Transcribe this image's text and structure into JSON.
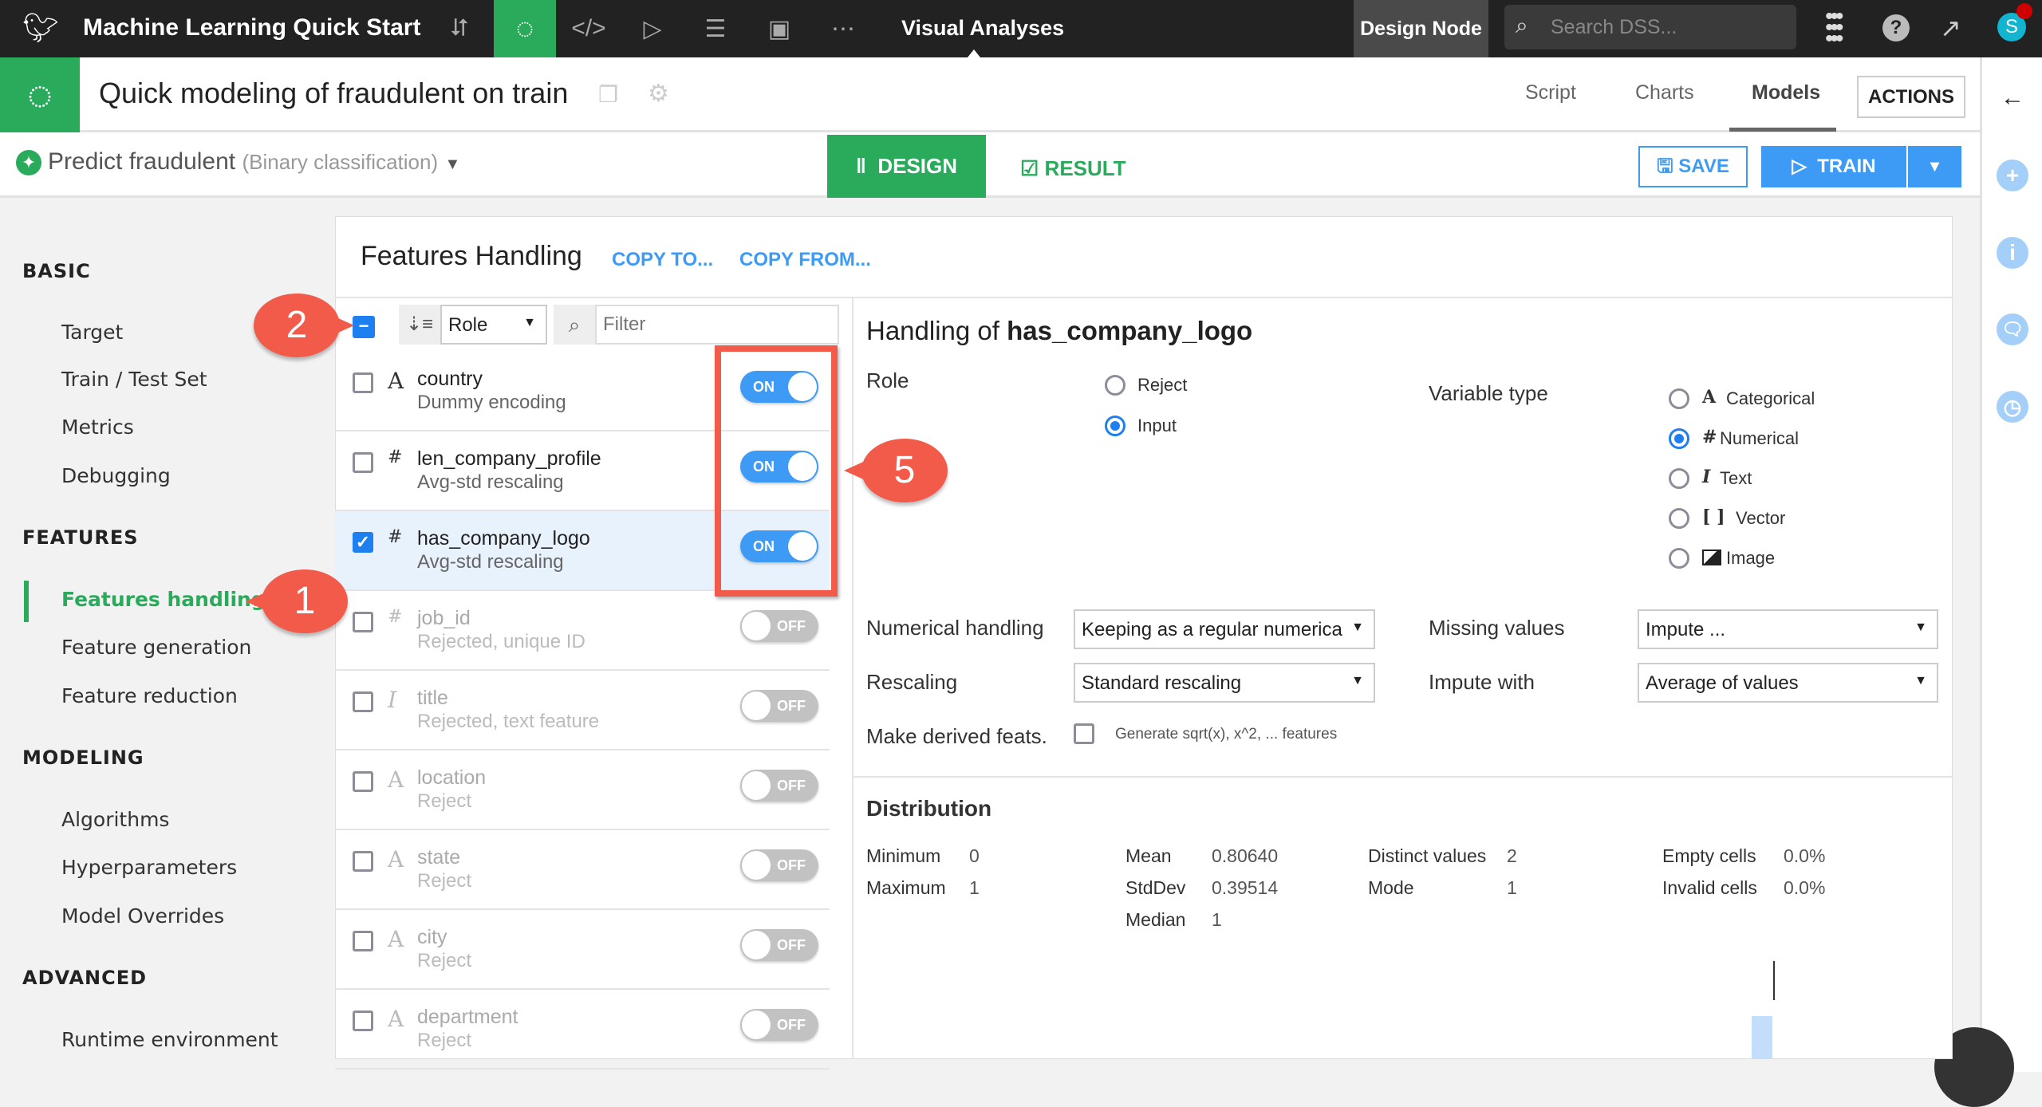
{
  "topbar": {
    "project_title": "Machine Learning Quick Start",
    "section": "Visual Analyses",
    "node": "Design Node",
    "search_placeholder": "Search DSS...",
    "avatar_letter": "S",
    "help": "?"
  },
  "header": {
    "title": "Quick modeling of fraudulent on train",
    "tabs": [
      "Script",
      "Charts",
      "Models"
    ],
    "active_tab": "Models",
    "actions_label": "ACTIONS"
  },
  "task": {
    "name": "Predict fraudulent",
    "type": "(Binary classification)",
    "design_label": "DESIGN",
    "result_label": "RESULT",
    "save_label": "SAVE",
    "train_label": "TRAIN"
  },
  "sidebar": {
    "sections": [
      {
        "title": "BASIC",
        "items": [
          "Target",
          "Train / Test Set",
          "Metrics",
          "Debugging"
        ]
      },
      {
        "title": "FEATURES",
        "items": [
          "Features handling",
          "Feature generation",
          "Feature reduction"
        ]
      },
      {
        "title": "MODELING",
        "items": [
          "Algorithms",
          "Hyperparameters",
          "Model Overrides"
        ]
      },
      {
        "title": "ADVANCED",
        "items": [
          "Runtime environment"
        ]
      }
    ],
    "active_item": "Features handling"
  },
  "features": {
    "title": "Features Handling",
    "copy_to": "COPY TO...",
    "copy_from": "COPY FROM...",
    "sort_value": "Role",
    "filter_placeholder": "Filter",
    "rows": [
      {
        "type": "A",
        "name": "country",
        "desc": "Dummy encoding",
        "enabled": true,
        "checked": false,
        "toggle": "ON"
      },
      {
        "type": "#",
        "name": "len_company_profile",
        "desc": "Avg-std rescaling",
        "enabled": true,
        "checked": false,
        "toggle": "ON"
      },
      {
        "type": "#",
        "name": "has_company_logo",
        "desc": "Avg-std rescaling",
        "enabled": true,
        "checked": true,
        "toggle": "ON"
      },
      {
        "type": "#",
        "name": "job_id",
        "desc": "Rejected, unique ID",
        "enabled": false,
        "checked": false,
        "toggle": "OFF"
      },
      {
        "type": "I",
        "name": "title",
        "desc": "Rejected, text feature",
        "enabled": false,
        "checked": false,
        "toggle": "OFF"
      },
      {
        "type": "A",
        "name": "location",
        "desc": "Reject",
        "enabled": false,
        "checked": false,
        "toggle": "OFF"
      },
      {
        "type": "A",
        "name": "state",
        "desc": "Reject",
        "enabled": false,
        "checked": false,
        "toggle": "OFF"
      },
      {
        "type": "A",
        "name": "city",
        "desc": "Reject",
        "enabled": false,
        "checked": false,
        "toggle": "OFF"
      },
      {
        "type": "A",
        "name": "department",
        "desc": "Reject",
        "enabled": false,
        "checked": false,
        "toggle": "OFF"
      }
    ]
  },
  "detail": {
    "heading_prefix": "Handling of",
    "feature": "has_company_logo",
    "role_label": "Role",
    "roles": [
      "Reject",
      "Input"
    ],
    "role_selected": "Input",
    "vartype_label": "Variable type",
    "vartypes": [
      {
        "icon": "A",
        "label": "Categorical"
      },
      {
        "icon": "#",
        "label": "Numerical"
      },
      {
        "icon": "I",
        "label": "Text"
      },
      {
        "icon": "[ ]",
        "label": "Vector"
      },
      {
        "icon": "image",
        "label": "Image"
      }
    ],
    "vartype_selected": "Numerical",
    "numerical_handling_label": "Numerical handling",
    "numerical_handling": "Keeping as a regular numerica",
    "missing_label": "Missing values",
    "missing": "Impute ...",
    "rescaling_label": "Rescaling",
    "rescaling": "Standard rescaling",
    "impute_label": "Impute with",
    "impute": "Average of values",
    "derived_label": "Make derived feats.",
    "derived_option": "Generate sqrt(x), x^2, ... features"
  },
  "distribution": {
    "title": "Distribution",
    "stats": [
      [
        "Minimum",
        "0"
      ],
      [
        "Maximum",
        "1"
      ],
      [
        "Mean",
        "0.80640"
      ],
      [
        "StdDev",
        "0.39514"
      ],
      [
        "Median",
        "1"
      ],
      [
        "Distinct values",
        "2"
      ],
      [
        "Mode",
        "1"
      ],
      [
        "Empty cells",
        "0.0%"
      ],
      [
        "Invalid cells",
        "0.0%"
      ]
    ]
  },
  "callouts": [
    "1",
    "2",
    "5"
  ],
  "colors": {
    "green": "#2aab5c",
    "blue": "#3d9bf5",
    "callout": "#f25a4a",
    "topbar": "#222222"
  }
}
